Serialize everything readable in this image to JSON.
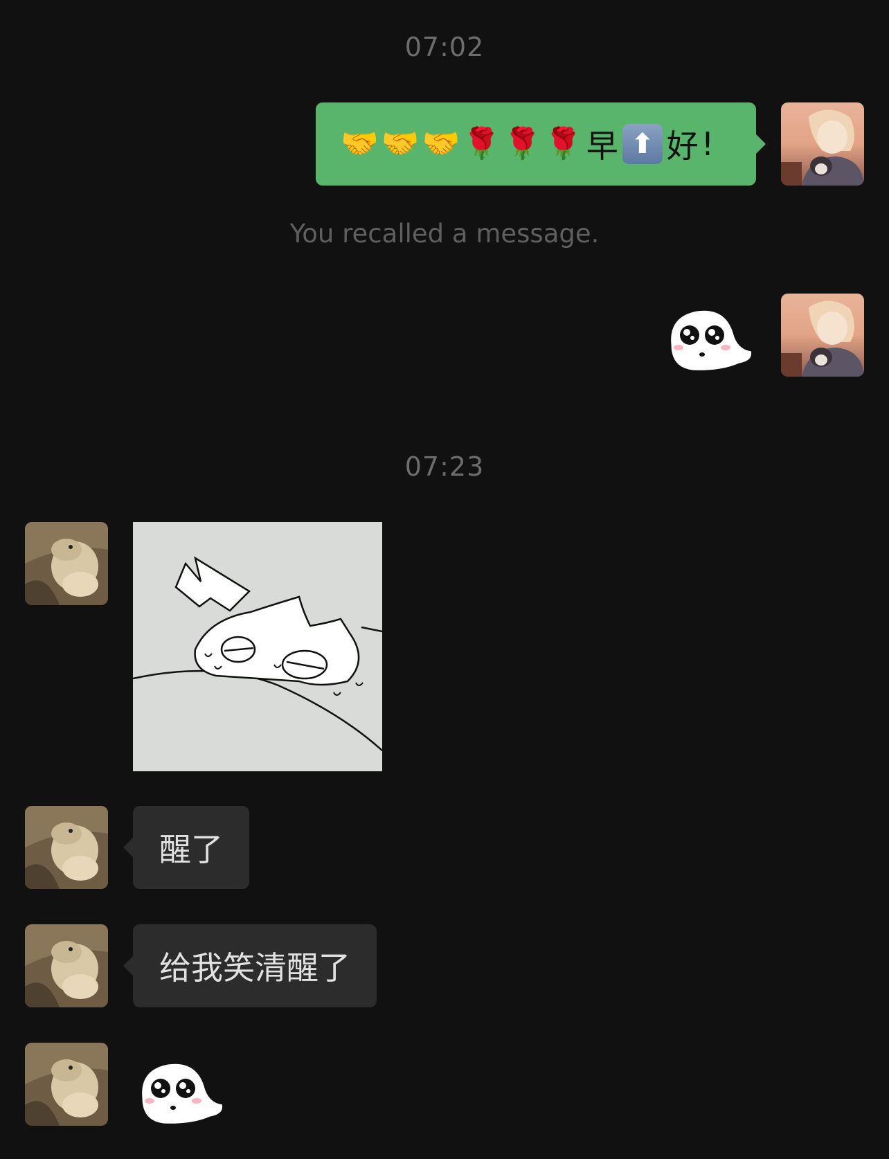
{
  "chat": {
    "timestamps": [
      "07:02",
      "07:23"
    ],
    "recalled_note": "You recalled a message.",
    "messages": {
      "out_greeting": {
        "emojis": [
          "🤝",
          "🤝",
          "🤝",
          "🌹",
          "🌹",
          "🌹"
        ],
        "char_before": "早",
        "up_icon": "⬆",
        "char_after": "好",
        "punct": "!"
      },
      "in_text_1": "醒了",
      "in_text_2": "给我笑清醒了"
    },
    "icons": {
      "handshake": "handshake-emoji",
      "rose": "rose-emoji",
      "up_arrow": "up-arrow-button-emoji",
      "ghost_sticker": "ghost-sticker"
    },
    "colors": {
      "background": "#111111",
      "out_bubble": "#58b56b",
      "in_bubble": "#2c2c2c"
    }
  }
}
